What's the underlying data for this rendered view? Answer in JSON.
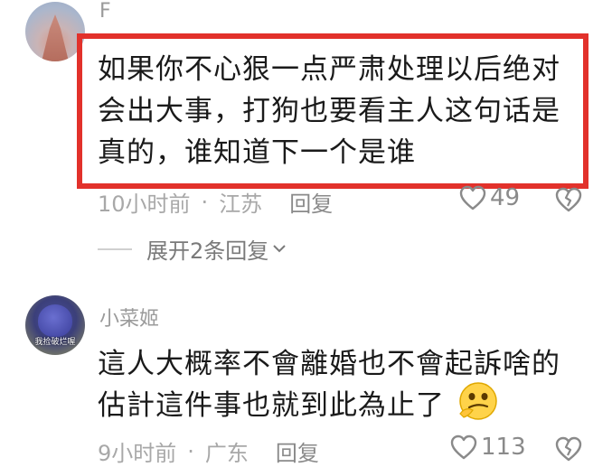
{
  "comment1": {
    "username_hint": "F",
    "text_line1": "如果你不心狠一点严肃处理以后绝对",
    "text_line2": "会出大事，打狗也要看主人这句话是",
    "text_line3": "真的，谁知道下一个是谁",
    "time": "10小时前",
    "location": "江苏",
    "reply_label": "回复",
    "likes": "49",
    "highlight_color": "#e2312b"
  },
  "expand_replies": {
    "label": "展开2条回复"
  },
  "comment2": {
    "username": "小菜姬",
    "avatar_caption": "我捡破烂喔",
    "text_line1": "這人大概率不會離婚也不會起訴啥的",
    "text_line2": "估計這件事也就到此為止了",
    "emoji": "thinking-face",
    "time": "9小时前",
    "location": "广东",
    "reply_label": "回复",
    "likes": "113"
  },
  "separator": "·",
  "icons": {
    "like": "heart-outline-icon",
    "dislike": "broken-heart-outline-icon",
    "chevron": "chevron-down-icon"
  }
}
